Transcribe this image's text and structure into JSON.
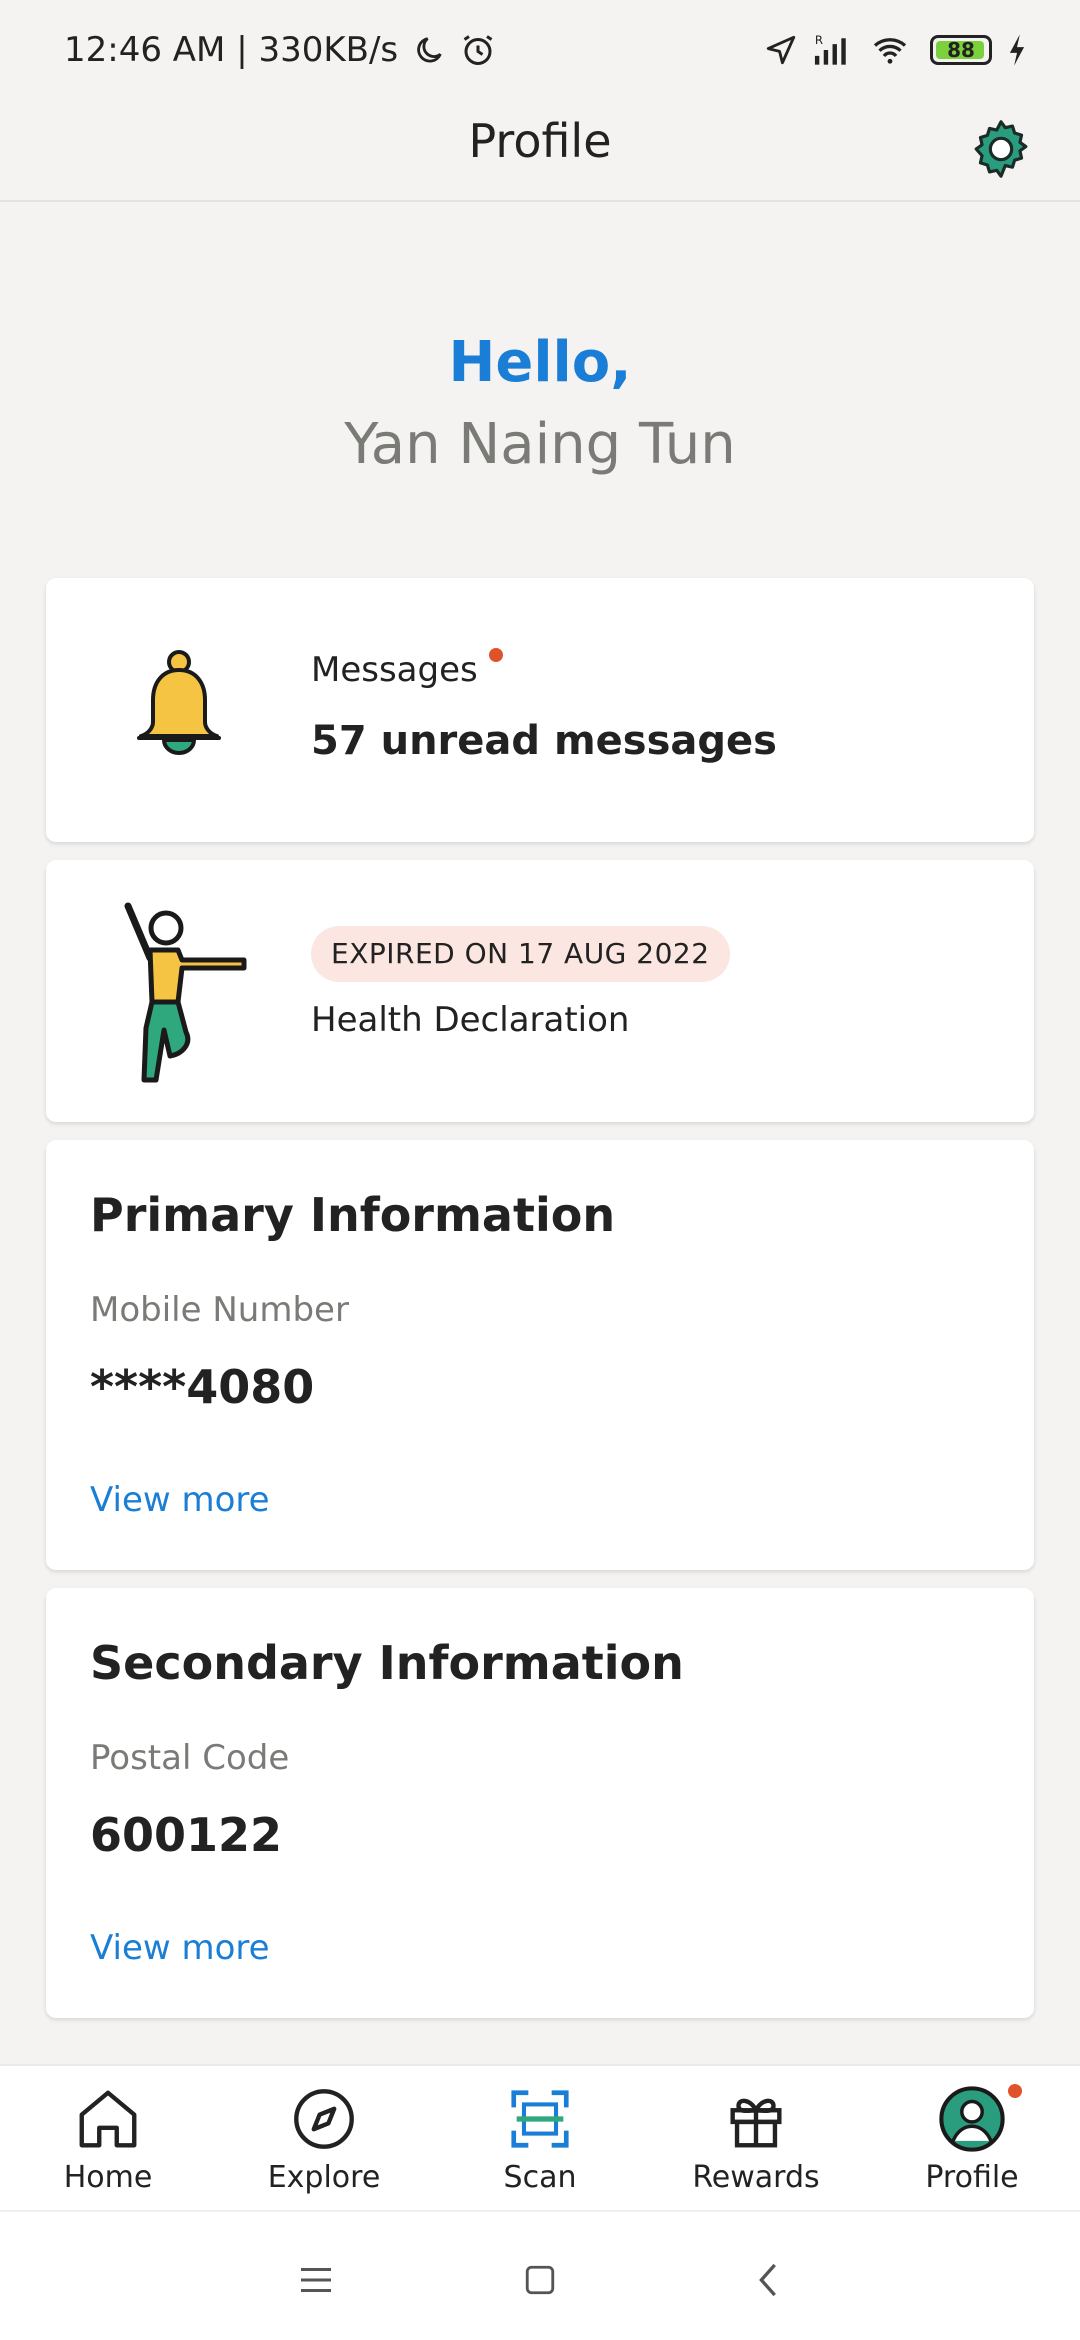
{
  "status_bar": {
    "time_speed": "12:46 AM | 330KB/s",
    "battery": "88"
  },
  "header": {
    "title": "Profile"
  },
  "greeting": {
    "hello": "Hello,",
    "name": "Yan Naing Tun"
  },
  "messages": {
    "label": "Messages",
    "count_text": "57 unread messages"
  },
  "health": {
    "badge": "EXPIRED ON 17 AUG 2022",
    "label": "Health Declaration"
  },
  "primary": {
    "title": "Primary Information",
    "field_label": "Mobile Number",
    "field_value": "****4080",
    "link": "View more"
  },
  "secondary": {
    "title": "Secondary Information",
    "field_label": "Postal Code",
    "field_value": "600122",
    "link": "View more"
  },
  "nav": {
    "items": [
      {
        "label": "Home",
        "icon": "home-icon"
      },
      {
        "label": "Explore",
        "icon": "compass-icon"
      },
      {
        "label": "Scan",
        "icon": "scan-icon"
      },
      {
        "label": "Rewards",
        "icon": "gift-icon"
      },
      {
        "label": "Profile",
        "icon": "profile-icon"
      }
    ]
  },
  "colors": {
    "accent_blue": "#1b7ed6",
    "teal": "#2a9d7f",
    "alert_red": "#e0522a",
    "badge_bg": "#fbe6e1"
  }
}
